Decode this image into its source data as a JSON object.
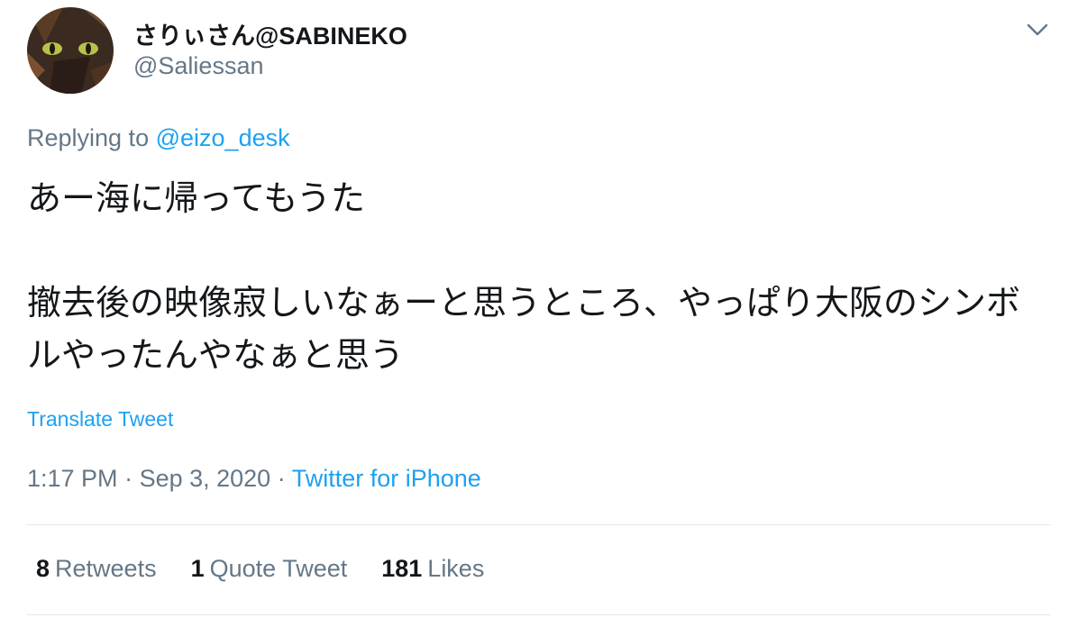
{
  "author": {
    "display_name": "さりぃさん@SABINEKO",
    "handle": "@Saliessan",
    "avatar": "tortoiseshell-cat-avatar"
  },
  "reply": {
    "prefix": "Replying to",
    "mention": "@eizo_desk"
  },
  "tweet": {
    "paragraphs": [
      "あー海に帰ってもうた",
      "撤去後の映像寂しいなぁーと思うところ、やっぱり大阪のシンボルやったんやなぁと思う"
    ]
  },
  "translate_label": "Translate Tweet",
  "meta": {
    "time": "1:17 PM",
    "separator": " · ",
    "date": "Sep 3, 2020",
    "source": "Twitter for iPhone"
  },
  "stats": {
    "retweets": {
      "count": "8",
      "label": "Retweets"
    },
    "quote_tweets": {
      "count": "1",
      "label": "Quote Tweet"
    },
    "likes": {
      "count": "181",
      "label": "Likes"
    }
  },
  "icons": {
    "more": "chevron-down-icon"
  },
  "colors": {
    "link": "#1da1f2",
    "secondary_text": "#657786",
    "primary_text": "#14171a",
    "divider": "#e1e8ed"
  }
}
